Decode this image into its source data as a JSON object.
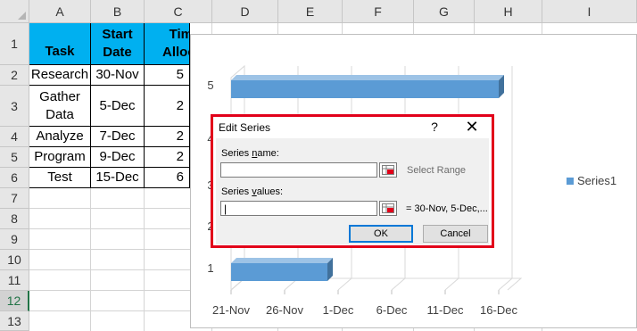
{
  "columns": [
    "A",
    "B",
    "C",
    "D",
    "E",
    "F",
    "G",
    "H",
    "I"
  ],
  "rows": [
    "1",
    "2",
    "3",
    "4",
    "5",
    "6",
    "7",
    "8",
    "9",
    "10",
    "11",
    "12",
    "13"
  ],
  "table": {
    "headers": [
      "Task",
      "Start\nDate",
      "Time\nAllocat"
    ],
    "rows": [
      {
        "task": "Research",
        "start": "30-Nov",
        "time": "5"
      },
      {
        "task": "Gather\nData",
        "start": "5-Dec",
        "time": "2"
      },
      {
        "task": "Analyze",
        "start": "7-Dec",
        "time": "2"
      },
      {
        "task": "Program",
        "start": "9-Dec",
        "time": "2"
      },
      {
        "task": "Test",
        "start": "15-Dec",
        "time": "6"
      }
    ]
  },
  "chart": {
    "series_color": "#5b9bd5",
    "legend": "Series1"
  },
  "chart_data": {
    "type": "bar",
    "orientation": "horizontal",
    "categories": [
      "1",
      "2",
      "3",
      "4",
      "5"
    ],
    "xlabels": [
      "21-Nov",
      "26-Nov",
      "1-Dec",
      "6-Dec",
      "11-Dec",
      "16-Dec"
    ],
    "series": [
      {
        "name": "Series1",
        "values": [
          {
            "category": "5",
            "start": "21-Nov",
            "end": "16-Dec"
          },
          {
            "category": "1",
            "start": "21-Nov",
            "end": "30-Nov"
          }
        ]
      }
    ]
  },
  "dialog": {
    "title": "Edit Series",
    "help": "?",
    "close": "✕",
    "name_label_pre": "Series ",
    "name_label_u": "n",
    "name_label_post": "ame:",
    "name_value": "",
    "name_hint": "Select Range",
    "values_label_pre": "Series ",
    "values_label_u": "v",
    "values_label_post": "alues:",
    "values_value": "|",
    "values_hint": "= 30-Nov, 5-Dec,...",
    "ok": "OK",
    "cancel": "Cancel",
    "accent": "#e2001a"
  }
}
